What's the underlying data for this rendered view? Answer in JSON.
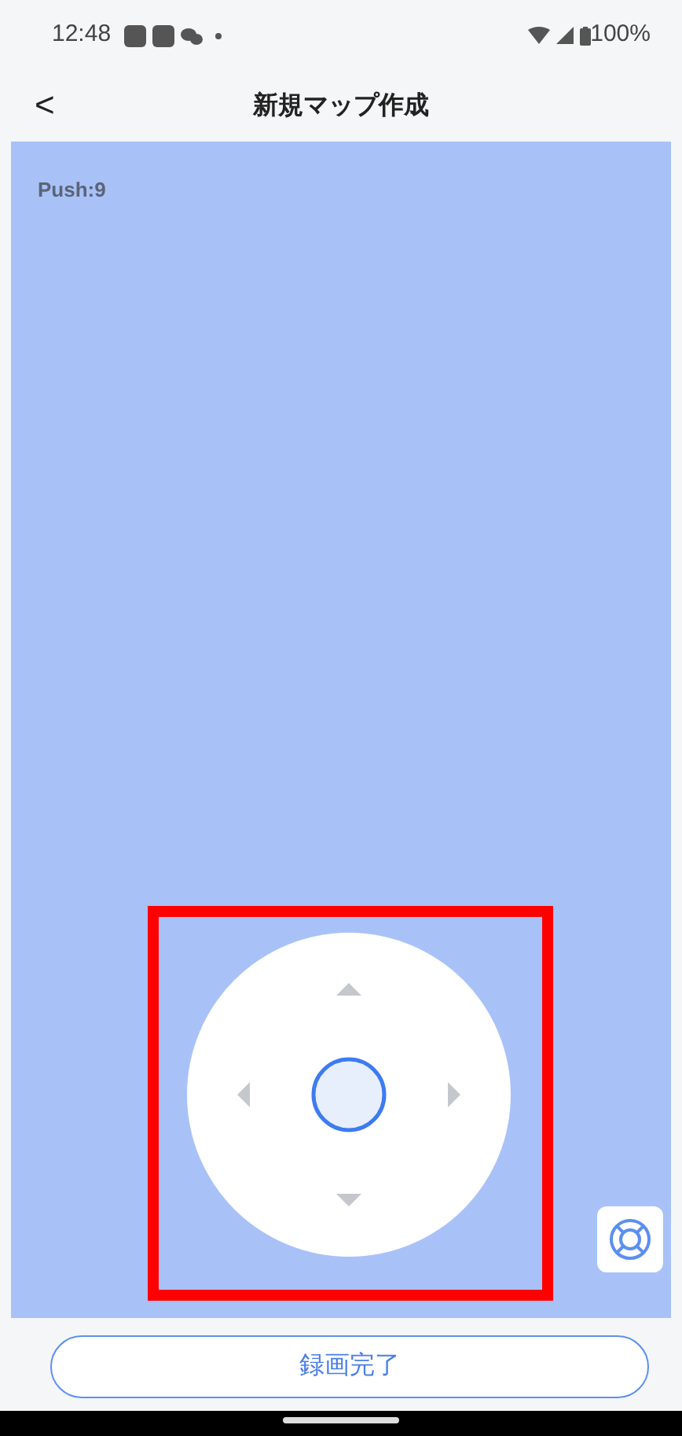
{
  "status_bar": {
    "time": "12:48",
    "battery": "100%"
  },
  "header": {
    "back": "<",
    "title": "新規マップ作成"
  },
  "map": {
    "push_label": "Push:9",
    "highlighted": true
  },
  "bottom": {
    "button": "録画完了"
  }
}
